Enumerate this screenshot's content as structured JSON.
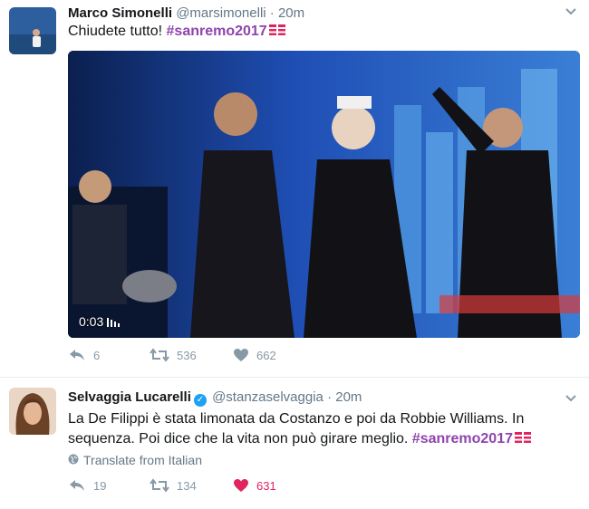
{
  "tweets": [
    {
      "name": "Marco Simonelli",
      "handle": "@marsimonelli",
      "separator": "·",
      "time": "20m",
      "text_plain": "Chiudete tutto! ",
      "hashtag": "#sanremo2017",
      "video_time": "0:03",
      "reply_count": "6",
      "retweet_count": "536",
      "like_count": "662"
    },
    {
      "name": "Selvaggia Lucarelli",
      "handle": "@stanzaselvaggia",
      "separator": "·",
      "time": "20m",
      "text_line1": "La De Filippi è stata limonata da Costanzo e poi da Robbie Williams. In",
      "text_line2_plain": "sequenza. Poi dice che la vita non può girare meglio. ",
      "hashtag": "#sanremo2017",
      "translate_label": "Translate from Italian",
      "reply_count": "19",
      "retweet_count": "134",
      "like_count": "631"
    }
  ],
  "colors": {
    "hashtag": "#8e44ad",
    "liked": "#e0245e",
    "icon_gray": "#8899a6",
    "verified": "#1da1f2"
  }
}
